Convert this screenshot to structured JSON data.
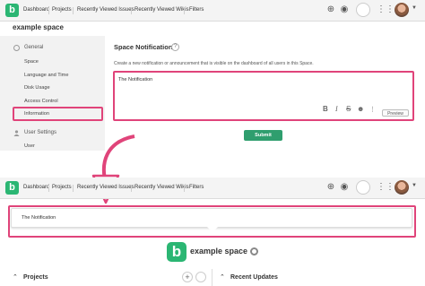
{
  "nav": {
    "logo_letter": "b",
    "items": [
      "Dashboard",
      "Projects",
      "Recently Viewed Issues",
      "Recently Viewed Wikis",
      "Filters"
    ]
  },
  "space": {
    "name": "example space"
  },
  "sidebar": {
    "general_heading": "General",
    "general_items": [
      "Space",
      "Language and Time",
      "Disk Usage",
      "Access Control",
      "Information"
    ],
    "user_heading": "User Settings",
    "user_items": [
      "User"
    ]
  },
  "main": {
    "title": "Space Notification",
    "help_glyph": "?",
    "description": "Create a new notification or announcement that is visible on the dashboard of all users in this Space.",
    "editor_text": "The Notification",
    "toolbar": {
      "bold": "B",
      "italic": "I",
      "strike": "S",
      "emoji": "☻",
      "preview": "Preview"
    },
    "submit_label": "Submit"
  },
  "bottom": {
    "notification_text": "The Notification",
    "space_name": "example space",
    "projects_label": "Projects",
    "recent_updates_label": "Recent Updates",
    "add_glyph": "+",
    "caret_up": "⌃"
  },
  "colors": {
    "accent": "#2bb673",
    "submit": "#2f9e6e",
    "highlight": "#e0447a"
  }
}
